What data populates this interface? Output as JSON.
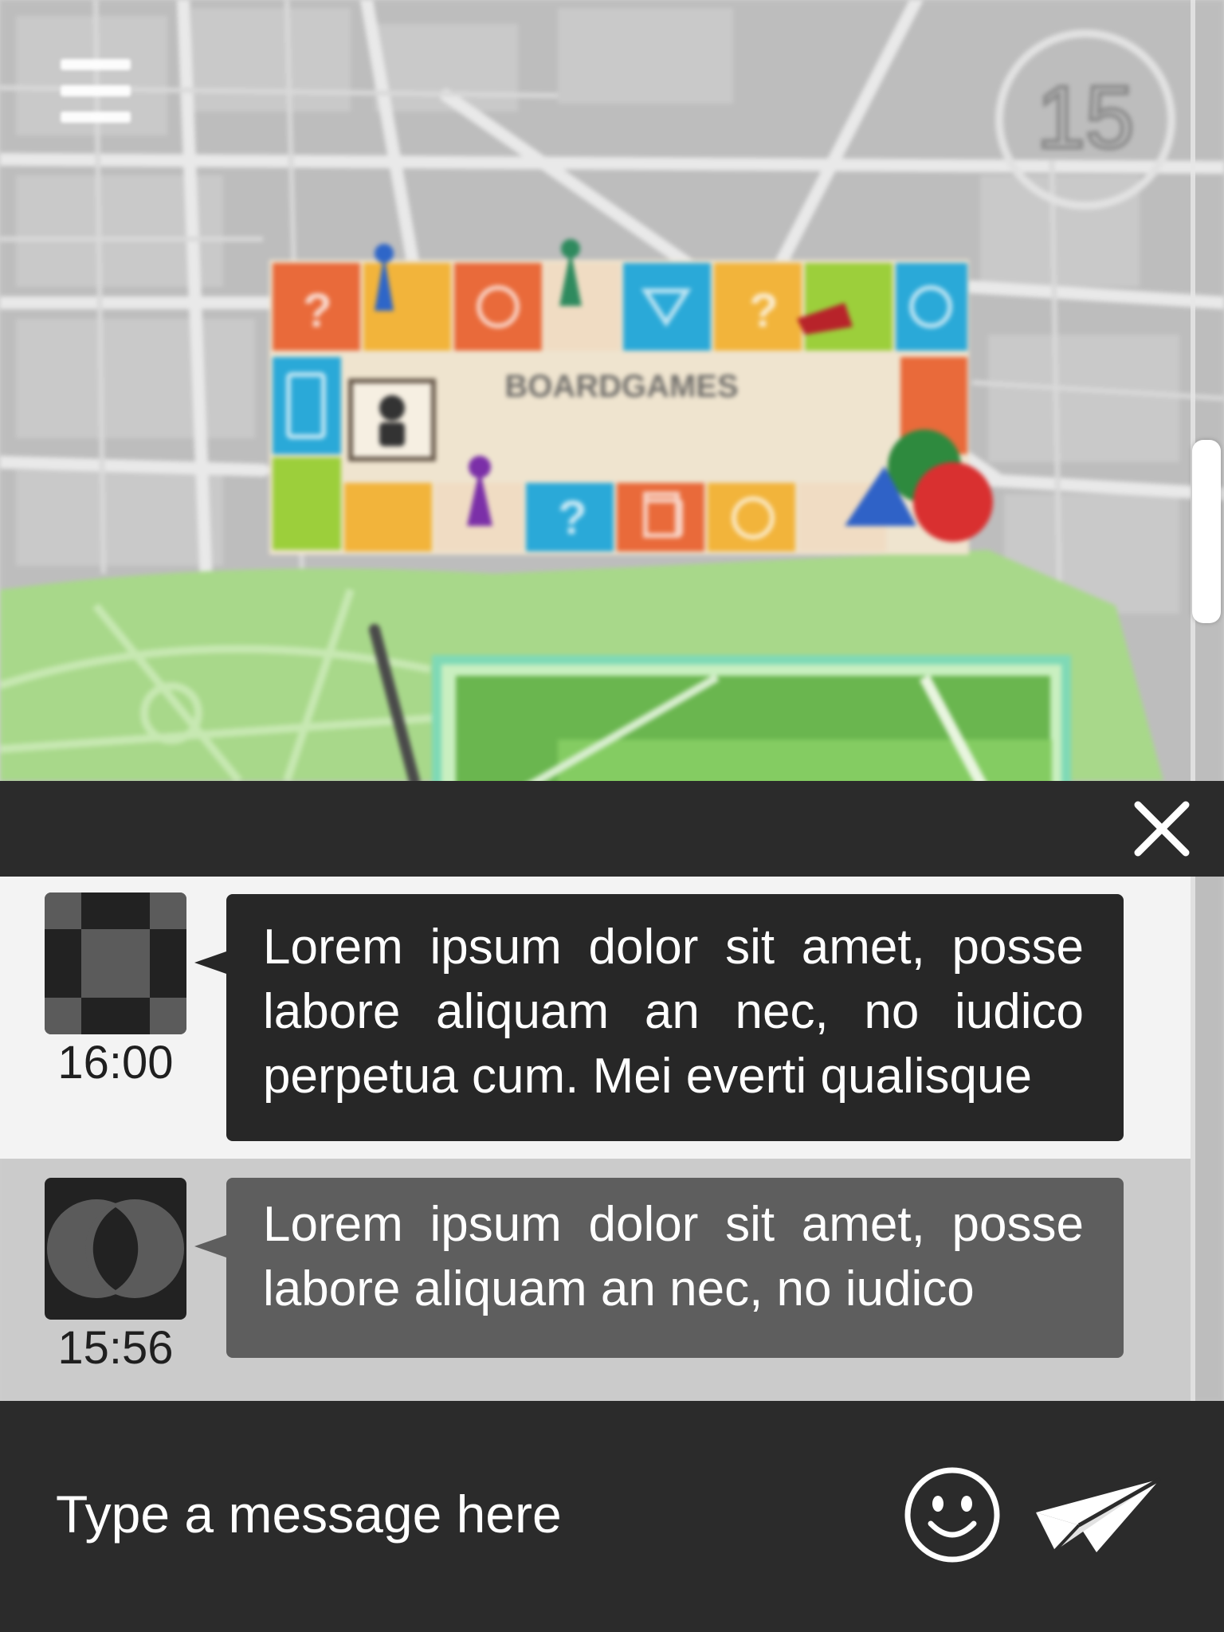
{
  "app": {
    "board_title": "BOARDGAMES",
    "badge_number": "15"
  },
  "header": {
    "menu_icon": "hamburger-menu-icon"
  },
  "chat": {
    "close_icon": "close-icon",
    "messages": [
      {
        "time": "16:00",
        "text": "Lorem ipsum dolor sit amet, posse labore aliquam an nec, no iudico perpetua cum. Mei everti qualisque",
        "avatar": "checkerboard-avatar"
      },
      {
        "time": "15:56",
        "text": "Lorem ipsum dolor sit amet, posse labore aliquam an nec, no iudico",
        "avatar": "overlapping-circles-avatar"
      }
    ]
  },
  "composer": {
    "placeholder": "Type a message here",
    "emoji_icon": "smiley-icon",
    "send_icon": "paper-plane-icon"
  },
  "colors": {
    "header": "#2b2b2b",
    "bubble_dark": "#272727",
    "bubble_grey": "#5e5e5e",
    "map_green": "#a8d88a"
  }
}
